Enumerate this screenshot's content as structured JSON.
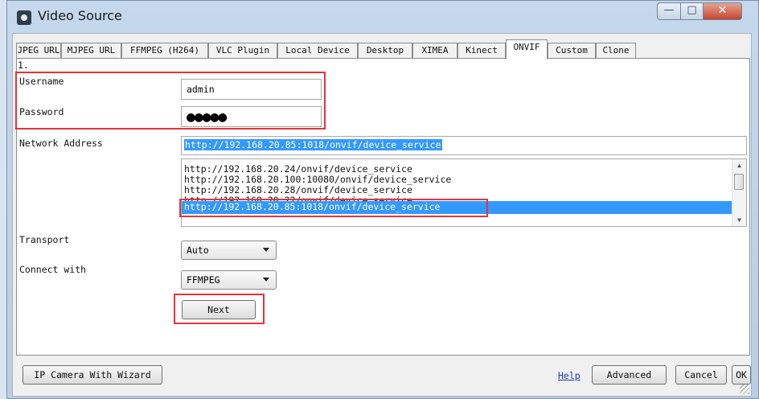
{
  "window": {
    "title": "Video Source",
    "minimize_glyph": "—",
    "maximize_glyph": "□",
    "close_glyph": "✕"
  },
  "tabs": [
    {
      "label": "JPEG URL"
    },
    {
      "label": "MJPEG URL"
    },
    {
      "label": "FFMPEG (H264)"
    },
    {
      "label": "VLC Plugin"
    },
    {
      "label": "Local Device"
    },
    {
      "label": "Desktop"
    },
    {
      "label": "XIMEA"
    },
    {
      "label": "Kinect"
    },
    {
      "label": "ONVIF",
      "active": true
    },
    {
      "label": "Custom"
    },
    {
      "label": "Clone"
    }
  ],
  "step_label": "1.",
  "form": {
    "username_label": "Username",
    "username_value": "admin",
    "password_label": "Password",
    "password_mask": "●●●●●",
    "network_address_label": "Network Address",
    "network_address_value": "http://192.168.20.85:1018/onvif/device_service",
    "address_list": [
      "http://192.168.20.24/onvif/device_service",
      "http://192.168.20.100:10080/onvif/device_service",
      "http://192.168.20.28/onvif/device_service",
      "http://192.168.20.22/onvif/device_service",
      "http://192.168.20.85:1018/onvif/device_service"
    ],
    "selected_address": "http://192.168.20.85:1018/onvif/device_service",
    "transport_label": "Transport",
    "transport_value": "Auto",
    "connect_with_label": "Connect with",
    "connect_with_value": "FFMPEG",
    "next_button": "Next"
  },
  "footer": {
    "wizard_button": "IP Camera With Wizard",
    "help_link": "Help",
    "advanced_button": "Advanced",
    "cancel_button": "Cancel",
    "ok_button": "OK"
  },
  "colors": {
    "highlight": "#e8333a",
    "selection": "#3399ff"
  }
}
